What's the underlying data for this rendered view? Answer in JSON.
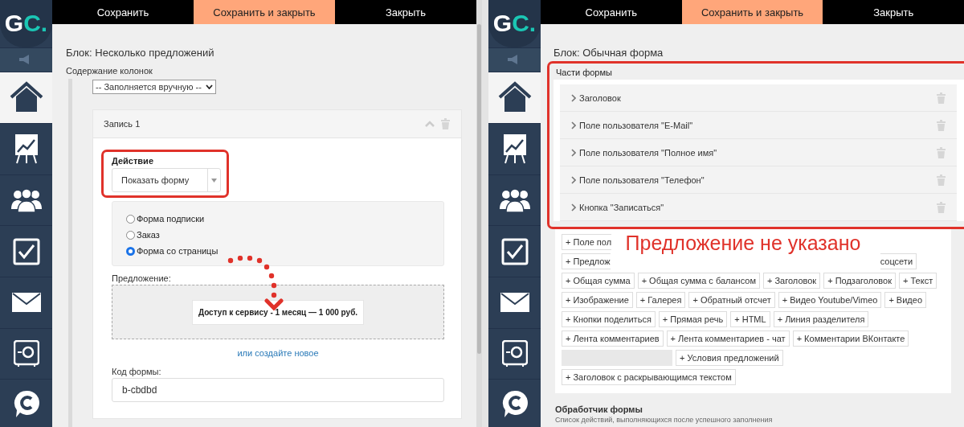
{
  "panels": [
    {
      "logo": {
        "letters": "G",
        "accent": "C."
      },
      "sidebar": [
        {
          "kind": "speaker",
          "selected": false
        },
        {
          "kind": "home",
          "selected": true
        },
        {
          "kind": "chart",
          "selected": false
        },
        {
          "kind": "people",
          "selected": false
        },
        {
          "kind": "check",
          "selected": false
        },
        {
          "kind": "mail",
          "selected": false
        },
        {
          "kind": "safe",
          "selected": false
        },
        {
          "kind": "chat",
          "selected": false
        }
      ],
      "toolbar": [
        {
          "label": "Сохранить",
          "selected": false
        },
        {
          "label": "Сохранить и закрыть",
          "selected": true
        },
        {
          "label": "Закрыть",
          "selected": false
        }
      ],
      "content": {
        "kind": "offers",
        "block_title": "Блок: Несколько предложений",
        "columns_label": "Содержание колонок",
        "source_select": "-- Заполняется вручную --",
        "record": {
          "title": "Запись 1",
          "action_label": "Действие",
          "action_value": "Показать форму",
          "options": [
            {
              "label": "Форма подписки",
              "selected": false
            },
            {
              "label": "Заказ",
              "selected": false
            },
            {
              "label": "Форма со страницы",
              "selected": true
            }
          ],
          "offer_label": "Предложение:",
          "offer_value": "Доступ к сервису - 1 месяц — 1 000 руб.",
          "create_link": "или создайте новое",
          "code_label": "Код формы:",
          "code_value": "b-cbdbd"
        }
      }
    },
    {
      "logo": {
        "letters": "G",
        "accent": "C."
      },
      "sidebar": [
        {
          "kind": "speaker",
          "selected": false
        },
        {
          "kind": "home",
          "selected": true
        },
        {
          "kind": "chart",
          "selected": false
        },
        {
          "kind": "people",
          "selected": false
        },
        {
          "kind": "check",
          "selected": false
        },
        {
          "kind": "mail",
          "selected": false
        },
        {
          "kind": "safe",
          "selected": false
        },
        {
          "kind": "chat",
          "selected": false
        }
      ],
      "toolbar": [
        {
          "label": "Сохранить",
          "selected": false
        },
        {
          "label": "Сохранить и закрыть",
          "selected": true
        },
        {
          "label": "Закрыть",
          "selected": false
        }
      ],
      "content": {
        "kind": "form",
        "block_title": "Блок: Обычная форма",
        "parts_label": "Части формы",
        "parts": [
          "Заголовок",
          "Поле пользователя \"E-Mail\"",
          "Поле пользователя \"Полное имя\"",
          "Поле пользователя \"Телефон\"",
          "Кнопка \"Записаться\""
        ],
        "overlay_note": "Предложение не указано",
        "add_button_rows": [
          [
            {
              "kind": "cut_start",
              "label": "+ Поле пол"
            }
          ],
          [
            {
              "kind": "cut_start",
              "label": "+ Предлож"
            },
            {
              "kind": "cut_end",
              "label": "соцсети"
            }
          ],
          [
            {
              "kind": "chip",
              "label": "+ Общая сумма"
            },
            {
              "kind": "chip",
              "label": "+ Общая сумма с балансом"
            },
            {
              "kind": "chip",
              "label": "+ Заголовок"
            },
            {
              "kind": "chip",
              "label": "+ Подзаголовок"
            },
            {
              "kind": "chip",
              "label": "+ Текст"
            }
          ],
          [
            {
              "kind": "chip",
              "label": "+ Изображение"
            },
            {
              "kind": "chip",
              "label": "+ Галерея"
            },
            {
              "kind": "chip",
              "label": "+ Обратный отсчет"
            },
            {
              "kind": "chip",
              "label": "+ Видео Youtube/Vimeo"
            },
            {
              "kind": "chip",
              "label": "+ Видео"
            }
          ],
          [
            {
              "kind": "chip",
              "label": "+ Кнопки поделиться"
            },
            {
              "kind": "chip",
              "label": "+ Прямая речь"
            },
            {
              "kind": "chip",
              "label": "+ HTML"
            },
            {
              "kind": "chip",
              "label": "+ Линия разделителя"
            }
          ],
          [
            {
              "kind": "chip",
              "label": "+ Лента комментариев"
            },
            {
              "kind": "chip",
              "label": "+ Лента комментариев - чат"
            },
            {
              "kind": "chip",
              "label": "+ Комментарии ВКонтакте"
            }
          ],
          [
            {
              "kind": "blurred"
            },
            {
              "kind": "chip",
              "label": "+ Условия предложений"
            }
          ],
          [
            {
              "kind": "chip",
              "label": "+ Заголовок с раскрывающимся текстом"
            }
          ]
        ],
        "handler_title": "Обработчик формы",
        "handler_hint": "Список действий, выполняющихся после успешного заполнения"
      }
    }
  ]
}
